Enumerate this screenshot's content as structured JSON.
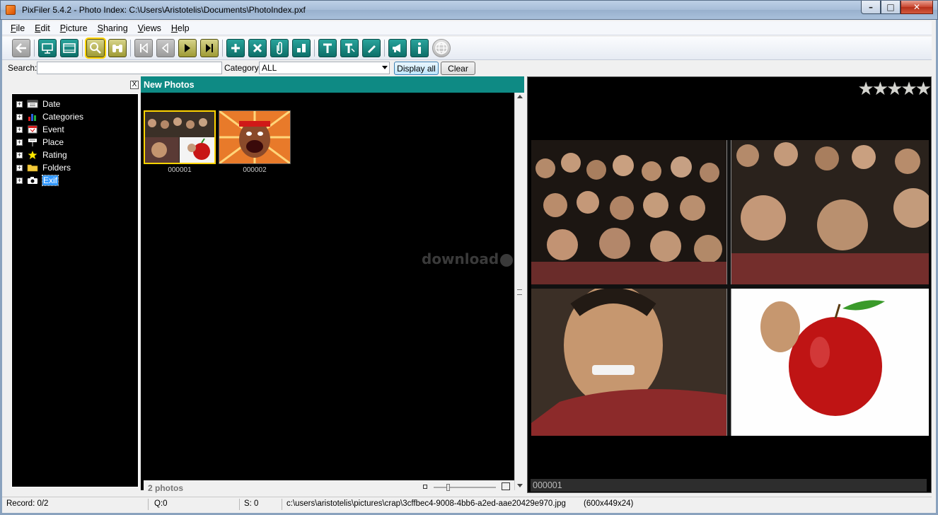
{
  "window": {
    "title": "PixFiler 5.4.2 - Photo Index: C:\\Users\\Aristotelis\\Documents\\PhotoIndex.pxf",
    "minimize": "–",
    "maximize": "□",
    "close": "✕"
  },
  "menu": [
    {
      "underline": "F",
      "rest": "ile"
    },
    {
      "underline": "E",
      "rest": "dit"
    },
    {
      "underline": "P",
      "rest": "icture"
    },
    {
      "underline": "S",
      "rest": "haring"
    },
    {
      "underline": "V",
      "rest": "iews"
    },
    {
      "underline": "H",
      "rest": "elp"
    }
  ],
  "toolbar": {
    "icons": [
      "back-icon",
      "slideshow-icon",
      "filmstrip-icon",
      "search-icon",
      "binoculars-icon",
      "first-icon",
      "previous-icon",
      "next-icon",
      "last-icon",
      "add-icon",
      "delete-icon",
      "clip-icon",
      "split-icon",
      "text-icon",
      "text-edit-icon",
      "edit-icon",
      "announce-icon",
      "info-icon",
      "globe-icon"
    ]
  },
  "search": {
    "label": "Search:",
    "value": "",
    "category_label": "Category:",
    "category_value": "ALL",
    "display_all": "Display all",
    "clear": "Clear"
  },
  "tree": {
    "close": "X",
    "items": [
      {
        "label": "Date",
        "icon": "calendar-icon"
      },
      {
        "label": "Categories",
        "icon": "categories-icon"
      },
      {
        "label": "Event",
        "icon": "event-icon"
      },
      {
        "label": "Place",
        "icon": "place-icon"
      },
      {
        "label": "Rating",
        "icon": "star-icon"
      },
      {
        "label": "Folders",
        "icon": "folder-icon"
      },
      {
        "label": "Exif",
        "icon": "camera-icon"
      }
    ]
  },
  "gallery": {
    "title": "New Photos",
    "thumbnails": [
      {
        "caption": "000001",
        "selected": true
      },
      {
        "caption": "000002",
        "selected": false
      }
    ],
    "count": "2 photos"
  },
  "preview": {
    "rating": "★★★★★",
    "caption": "000001",
    "watermark": "download"
  },
  "status": {
    "record": "Record: 0/2",
    "q": "Q:0",
    "s": "S: 0",
    "path": "c:\\users\\aristotelis\\pictures\\crap\\3cffbec4-9008-4bb6-a2ed-aae20429e970.jpg",
    "dims": "(600x449x24)"
  },
  "colors": {
    "accent": "#0e8a84",
    "selection": "#3399ff",
    "thumb_highlight": "#ffd400"
  }
}
